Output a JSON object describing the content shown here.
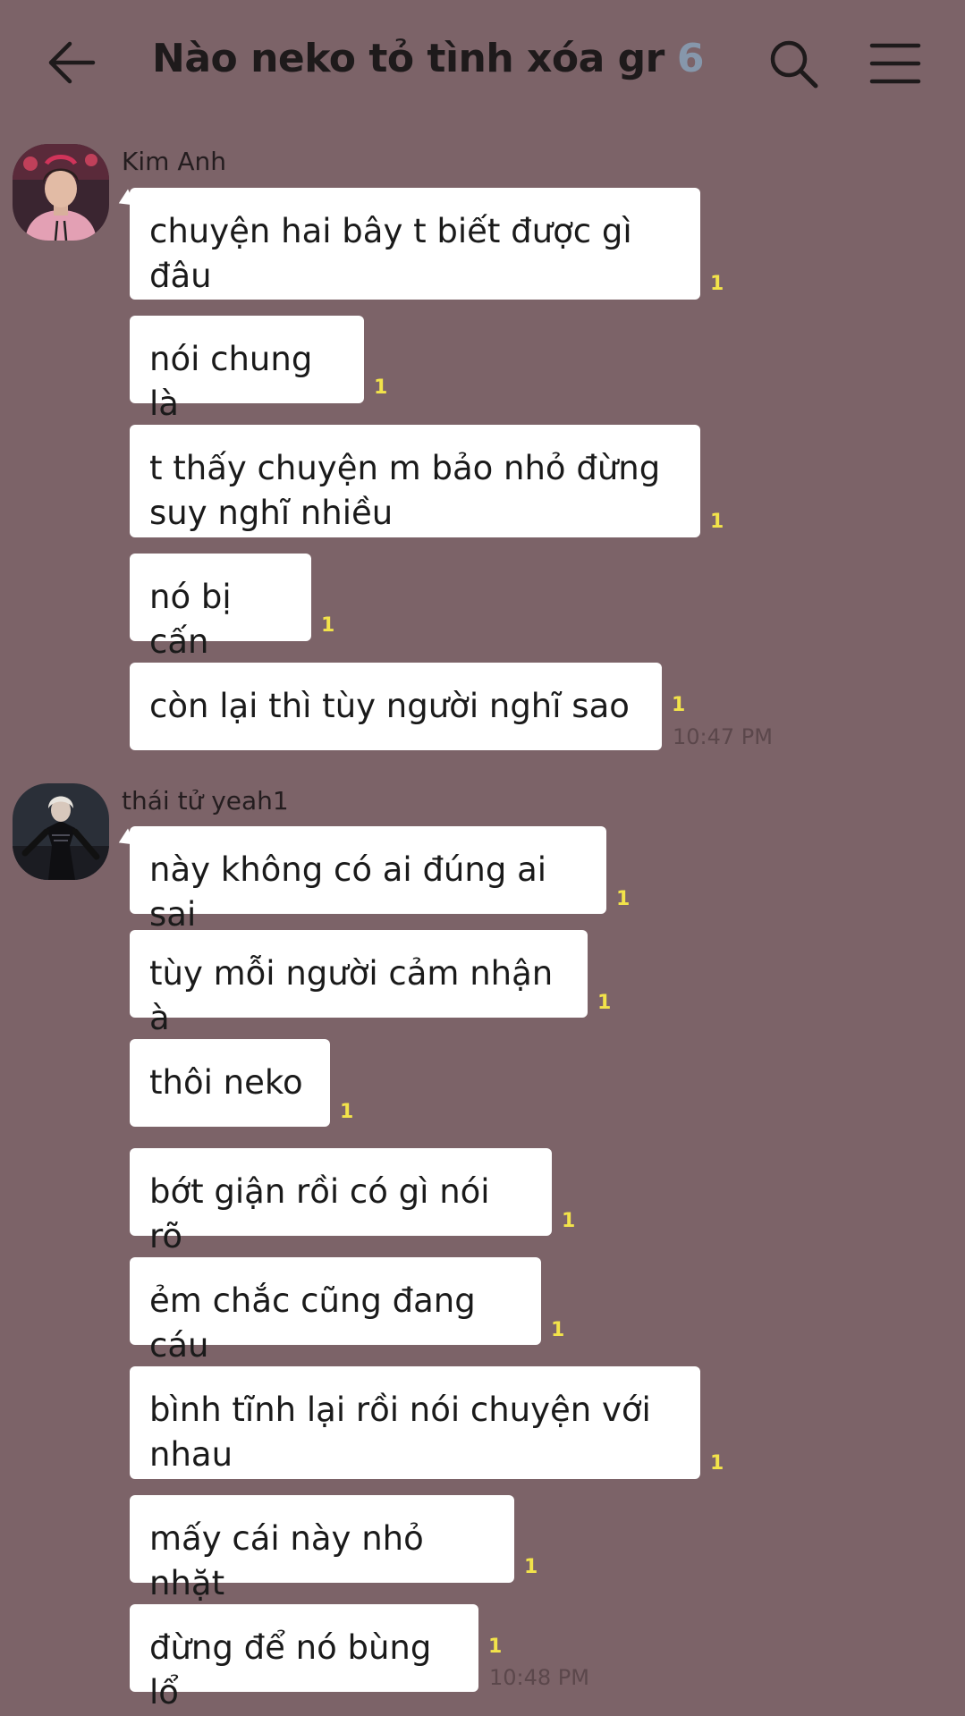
{
  "header": {
    "title": "Nào neko tỏ tình xóa gr",
    "member_count": "6"
  },
  "groups": [
    {
      "sender": "Kim Anh",
      "avatar_icon": "avatar-pink-hoodie",
      "messages": [
        {
          "text": "chuyện hai bây t biết được gì đâu",
          "unread": "1"
        },
        {
          "text": "nói chung là",
          "unread": "1"
        },
        {
          "text": "t thấy chuyện m bảo nhỏ đừng suy nghĩ nhiều",
          "unread": "1"
        },
        {
          "text": "nó bị cấn",
          "unread": "1"
        },
        {
          "text": "còn lại thì tùy người nghĩ sao",
          "unread": "1",
          "time": "10:47 PM"
        }
      ]
    },
    {
      "sender": "thái tử yeah1",
      "avatar_icon": "avatar-dark-costume",
      "messages": [
        {
          "text": "này không có ai đúng ai sai",
          "unread": "1"
        },
        {
          "text": "tùy mỗi người cảm nhận à",
          "unread": "1"
        },
        {
          "text": "thôi neko",
          "unread": "1"
        },
        {
          "text": "bớt giận rồi có gì nói rõ",
          "unread": "1"
        },
        {
          "text": "ẻm chắc cũng đang cáu",
          "unread": "1"
        },
        {
          "text": "bình tĩnh lại rồi nói chuyện với nhau",
          "unread": "1"
        },
        {
          "text": "mấy cái này nhỏ nhặt",
          "unread": "1"
        },
        {
          "text": "đừng để nó bùng lổ",
          "unread": "1",
          "time": "10:48 PM"
        }
      ]
    }
  ],
  "colors": {
    "background": "#7c6368",
    "bubble": "#ffffff",
    "unread": "#f2e34a",
    "member_count": "#8697ab"
  }
}
